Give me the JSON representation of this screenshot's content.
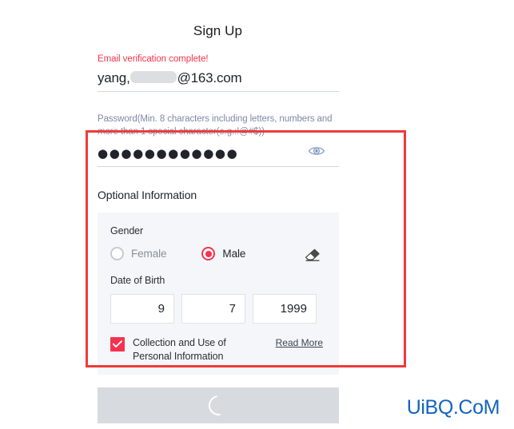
{
  "page": {
    "title": "Sign Up"
  },
  "email_section": {
    "status_text": "Email verification complete!",
    "value_prefix": "yang,",
    "value_suffix": "@163.com",
    "redaction_name": "redacted-email-local-part"
  },
  "password_section": {
    "hint_line1": "Password(Min. 8 characters including letters, numbers and",
    "hint_line2": "more than 1 special character(e.g.:!@#$))",
    "masked_value": "●●●●●●●●●●●●",
    "toggle_icon": "eye-icon"
  },
  "optional": {
    "section_title": "Optional Information",
    "gender": {
      "label": "Gender",
      "options": [
        {
          "label": "Female",
          "selected": false
        },
        {
          "label": "Male",
          "selected": true
        }
      ],
      "clear_icon": "eraser-icon"
    },
    "dob": {
      "label": "Date of Birth",
      "month": "9",
      "day": "7",
      "year": "1999"
    },
    "consent": {
      "checked": true,
      "text_line1": "Collection and Use of",
      "text_line2": "Personal Information",
      "read_more_label": "Read More"
    }
  },
  "submit": {
    "state": "loading",
    "spinner_name": "loading-spinner"
  },
  "watermark": {
    "text": "UiBQ.CoM"
  },
  "colors": {
    "accent_red": "#f5334f",
    "annotation_red": "#ef3b38",
    "hint_blue_gray": "#7d89a6",
    "panel_gray": "#f4f6f9",
    "button_disabled": "#d7dbe0",
    "watermark_blue": "#1464c0"
  }
}
